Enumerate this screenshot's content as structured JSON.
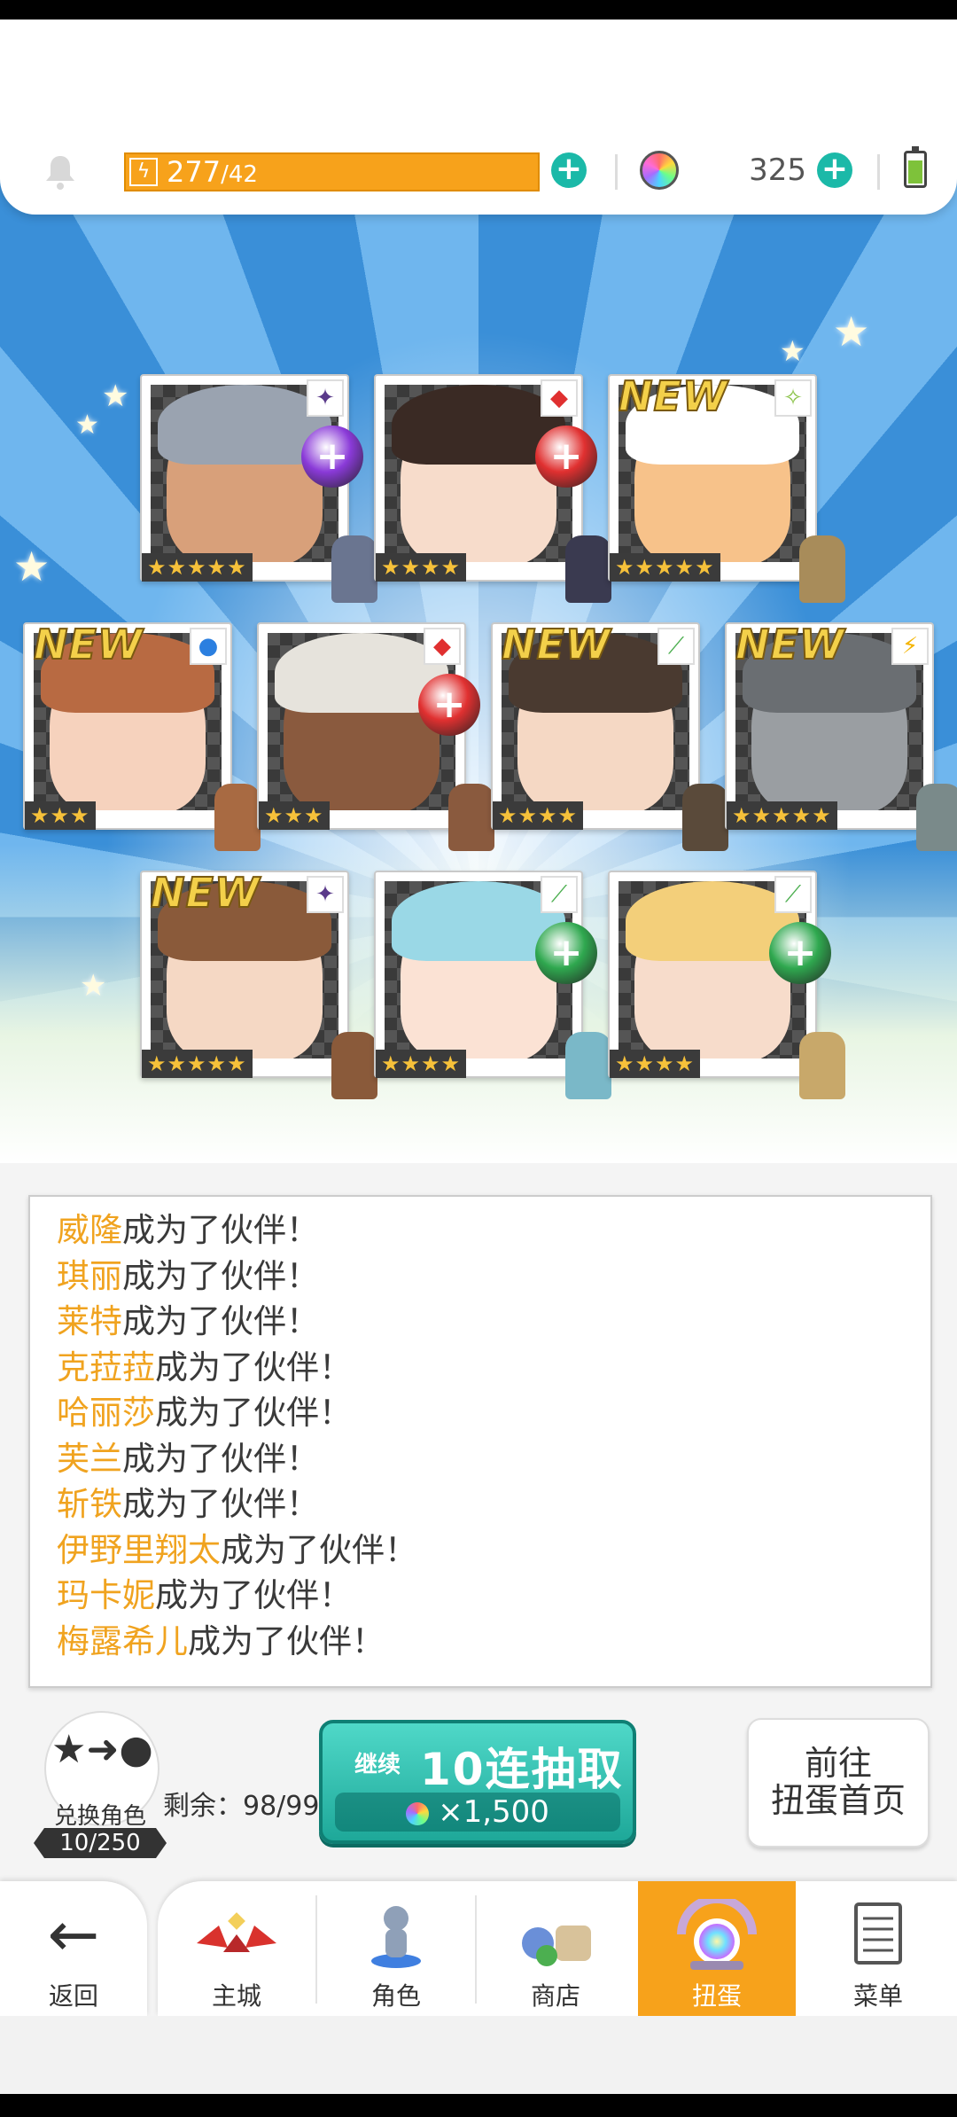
{
  "status": {
    "stamina_current": "277",
    "stamina_max": "42",
    "gems": "325"
  },
  "cards": [
    {
      "rarity": "★★★★★",
      "new": "",
      "element": "✦",
      "element_color": "#5a3a8a",
      "orb_color": "#8a3ad8",
      "hair": "#9aa3b0",
      "skin": "#d8a07a",
      "sprite": "#6a7590"
    },
    {
      "rarity": "★★★★",
      "new": "",
      "element": "◆",
      "element_color": "#e03030",
      "orb_color": "#e03030",
      "hair": "#3a2a24",
      "skin": "#f7dccb",
      "sprite": "#3a3a50"
    },
    {
      "rarity": "★★★★★",
      "new": "NEW",
      "element": "✧",
      "element_color": "#8bc34a",
      "orb_color": "",
      "hair": "#ffffff",
      "skin": "#f7c28a",
      "sprite": "#a88c5a"
    },
    {
      "rarity": "★★★",
      "new": "NEW",
      "element": "●",
      "element_color": "#2b7fe0",
      "orb_color": "",
      "hair": "#b86a42",
      "skin": "#f6d2bd",
      "sprite": "#a86a42"
    },
    {
      "rarity": "★★★",
      "new": "",
      "element": "◆",
      "element_color": "#e03030",
      "orb_color": "#e03030",
      "hair": "#e6e3dc",
      "skin": "#8a5a3e",
      "sprite": "#8a5a3e"
    },
    {
      "rarity": "★★★★",
      "new": "NEW",
      "element": "⟋",
      "element_color": "#4caf50",
      "orb_color": "",
      "hair": "#4a3a30",
      "skin": "#f5d8c4",
      "sprite": "#5a4a3a"
    },
    {
      "rarity": "★★★★★",
      "new": "NEW",
      "element": "⚡",
      "element_color": "#f4b400",
      "orb_color": "",
      "hair": "#6a6e72",
      "skin": "#9a9ea2",
      "sprite": "#7a8a8a"
    },
    {
      "rarity": "★★★★★",
      "new": "NEW",
      "element": "✦",
      "element_color": "#5a3a8a",
      "orb_color": "",
      "hair": "#8a5a3a",
      "skin": "#f5d8c4",
      "sprite": "#8a5a3a"
    },
    {
      "rarity": "★★★★",
      "new": "",
      "element": "⟋",
      "element_color": "#4caf50",
      "orb_color": "#2fa84f",
      "hair": "#9ad8e6",
      "skin": "#fbe2d4",
      "sprite": "#7ab8c8"
    },
    {
      "rarity": "★★★★",
      "new": "",
      "element": "⟋",
      "element_color": "#4caf50",
      "orb_color": "#2fa84f",
      "hair": "#f3cf7a",
      "skin": "#f7dccb",
      "sprite": "#c8a86a"
    }
  ],
  "log": [
    {
      "name": "威隆",
      "suffix": "成为了伙伴！"
    },
    {
      "name": "琪丽",
      "suffix": "成为了伙伴！"
    },
    {
      "name": "莱特",
      "suffix": "成为了伙伴！"
    },
    {
      "name": "克菈菈",
      "suffix": "成为了伙伴！"
    },
    {
      "name": "哈丽莎",
      "suffix": "成为了伙伴！"
    },
    {
      "name": "芙兰",
      "suffix": "成为了伙伴！"
    },
    {
      "name": "斩铁",
      "suffix": "成为了伙伴！"
    },
    {
      "name": "伊野里翔太",
      "suffix": "成为了伙伴！"
    },
    {
      "name": "玛卡妮",
      "suffix": "成为了伙伴！"
    },
    {
      "name": "梅露希儿",
      "suffix": "成为了伙伴！"
    }
  ],
  "exchange": {
    "label": "兑换角色",
    "count": "10/250"
  },
  "remaining": "剩余：98/99",
  "pull_button": {
    "prefix": "继续",
    "label": "10连抽取",
    "cost": "×1,500"
  },
  "goto_button": {
    "line1": "前往",
    "line2": "扭蛋首页"
  },
  "nav": {
    "back": "返回",
    "items": [
      {
        "label": "主城",
        "icon": "castle-icon"
      },
      {
        "label": "角色",
        "icon": "character-icon"
      },
      {
        "label": "商店",
        "icon": "shop-icon"
      },
      {
        "label": "扭蛋",
        "icon": "gacha-icon"
      },
      {
        "label": "菜单",
        "icon": "menu-icon"
      }
    ]
  }
}
